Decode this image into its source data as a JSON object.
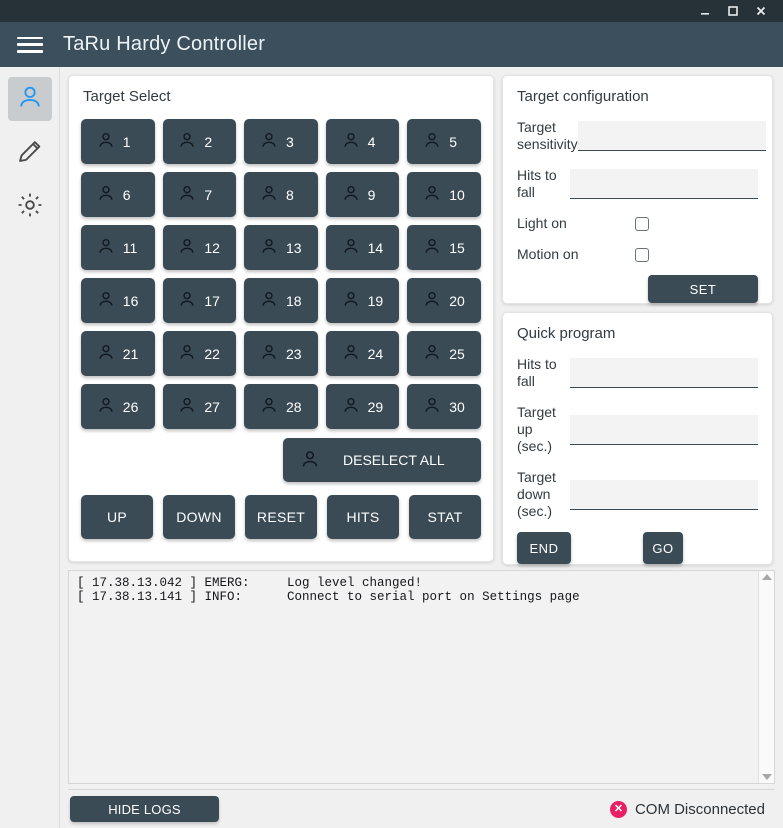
{
  "window": {
    "minimize_label": "minimize-icon",
    "maximize_label": "maximize-icon",
    "close_label": "close-icon"
  },
  "header": {
    "menu_icon": "hamburger-icon",
    "title": "TaRu Hardy Controller"
  },
  "sidebar": {
    "items": [
      {
        "icon": "user-icon",
        "name": "sidebar-item-user",
        "active": true
      },
      {
        "icon": "pencil-icon",
        "name": "sidebar-item-edit",
        "active": false
      },
      {
        "icon": "gear-icon",
        "name": "sidebar-item-settings",
        "active": false
      }
    ]
  },
  "target_select": {
    "title": "Target Select",
    "targets": [
      "1",
      "2",
      "3",
      "4",
      "5",
      "6",
      "7",
      "8",
      "9",
      "10",
      "11",
      "12",
      "13",
      "14",
      "15",
      "16",
      "17",
      "18",
      "19",
      "20",
      "21",
      "22",
      "23",
      "24",
      "25",
      "26",
      "27",
      "28",
      "29",
      "30"
    ],
    "deselect_all_label": "DESELECT ALL",
    "actions": [
      "UP",
      "DOWN",
      "RESET",
      "HITS",
      "STAT"
    ]
  },
  "target_configuration": {
    "title": "Target configuration",
    "sensitivity_label": "Target sensitivity",
    "sensitivity_value": "",
    "sensitivity_placeholder": "",
    "hits_to_fall_label": "Hits to fall",
    "hits_to_fall_value": "",
    "hits_to_fall_placeholder": "",
    "light_on_label": "Light on",
    "light_on_checked": false,
    "motion_on_label": "Motion on",
    "motion_on_checked": false,
    "set_label": "SET"
  },
  "quick_program": {
    "title": "Quick program",
    "hits_to_fall_label": "Hits to fall",
    "hits_to_fall_value": "",
    "hits_to_fall_placeholder": "",
    "target_up_label": "Target up (sec.)",
    "target_up_value": "",
    "target_up_placeholder": "",
    "target_down_label": "Target down (sec.)",
    "target_down_value": "",
    "target_down_placeholder": "",
    "end_label": "END",
    "go_label": "GO"
  },
  "logs": {
    "text": "[ 17.38.13.042 ] EMERG:     Log level changed!\n[ 17.38.13.141 ] INFO:      Connect to serial port on Settings page",
    "scroll_up_icon": "triangle-up-icon",
    "scroll_down_icon": "triangle-down-icon"
  },
  "status_bar": {
    "hide_logs_label": "HIDE LOGS",
    "connection_icon": "error-circle-icon",
    "connection_text": "COM Disconnected",
    "connection_color": "#e91e63"
  }
}
